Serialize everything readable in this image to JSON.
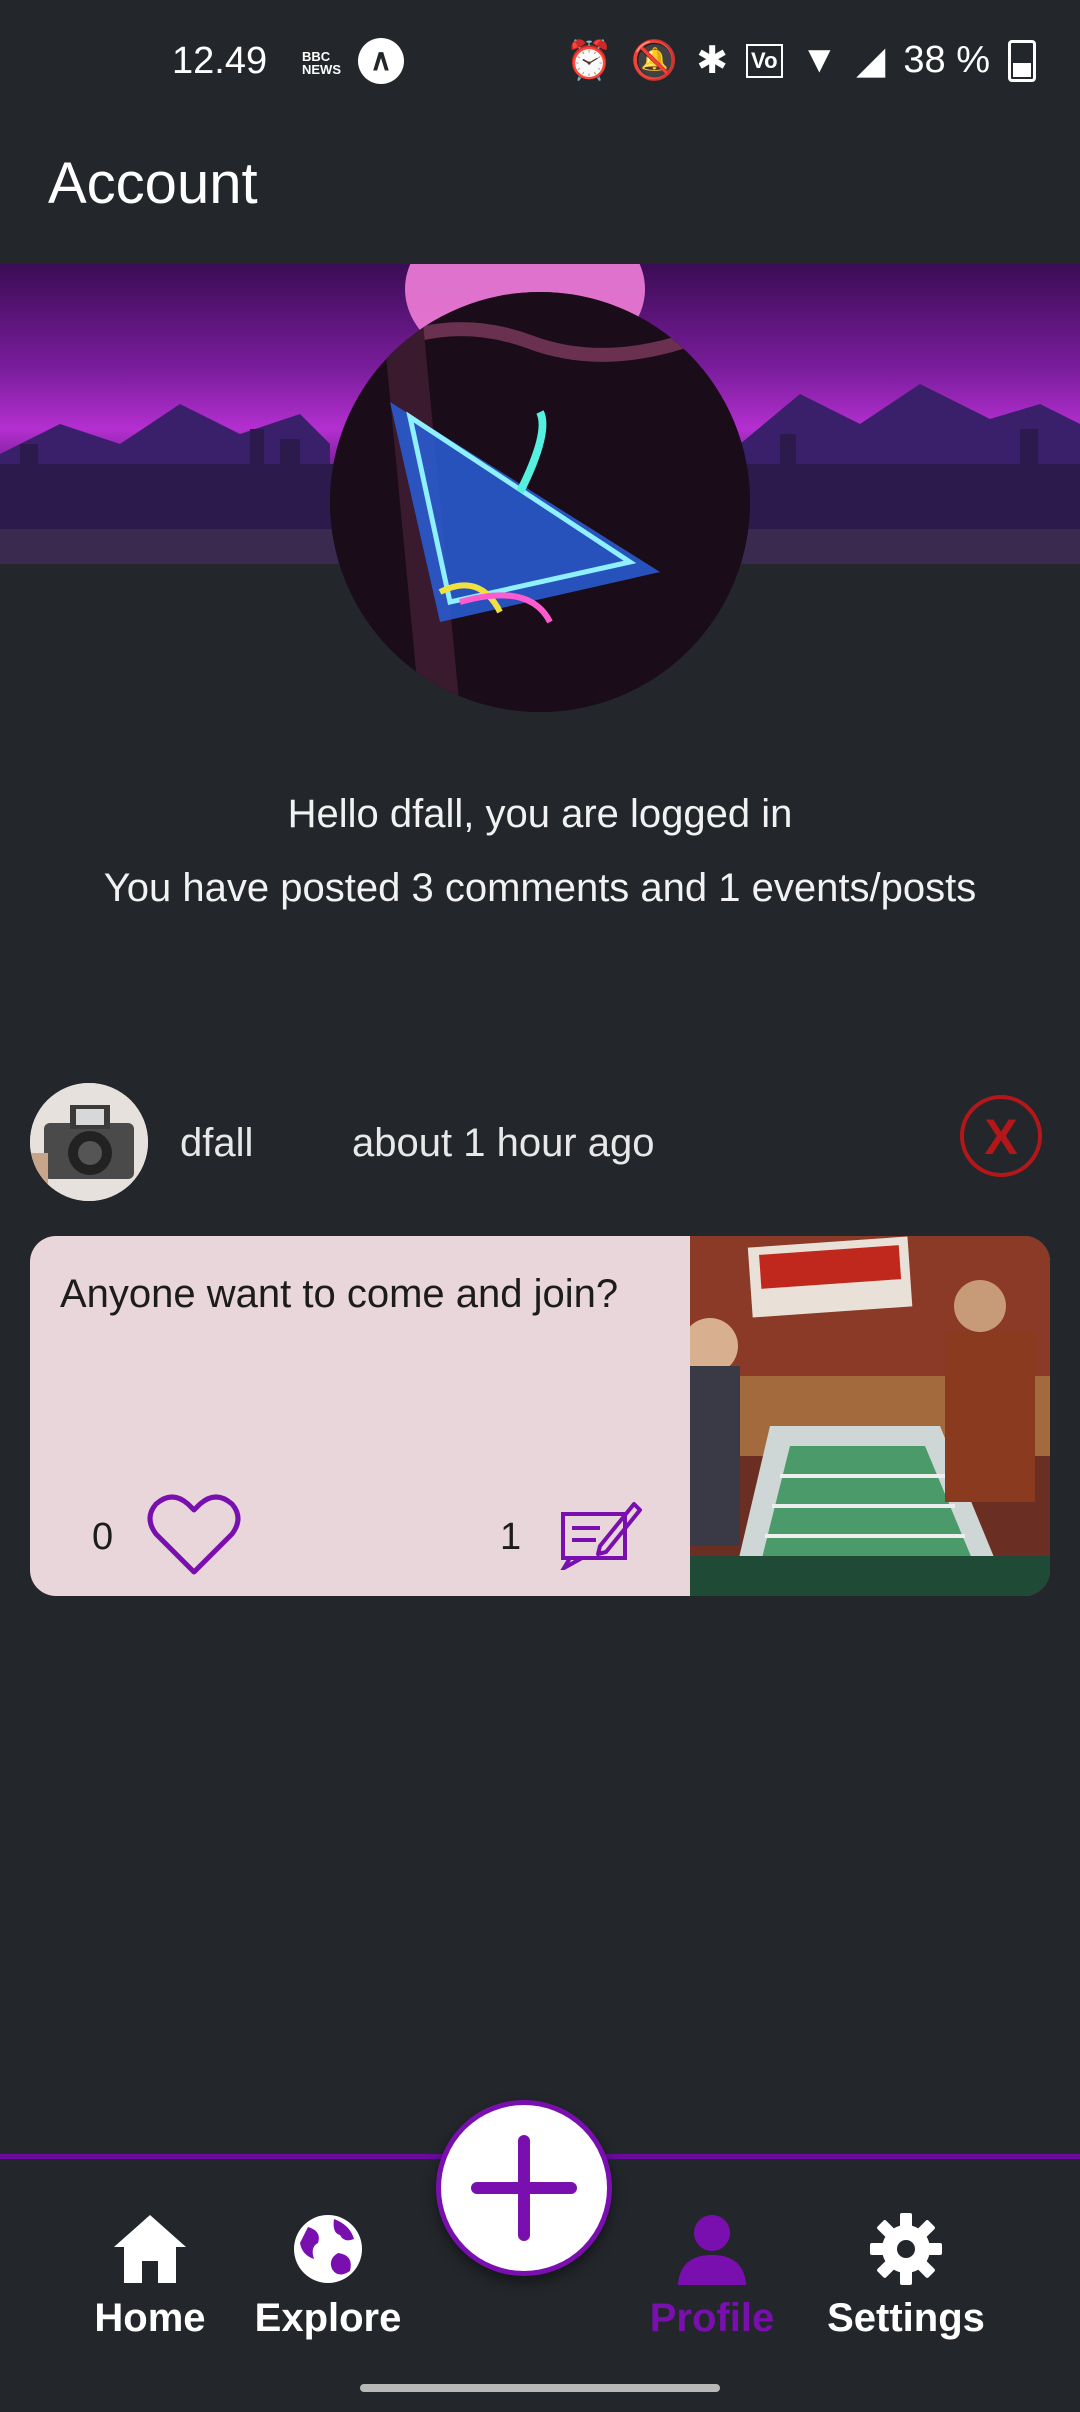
{
  "status_bar": {
    "time": "12.49",
    "bbc_news": "BBC NEWS",
    "battery": "38 %"
  },
  "app_bar": {
    "title": "Account"
  },
  "profile": {
    "greeting": "Hello dfall, you are logged in",
    "stats": "You have posted 3 comments and 1 events/posts"
  },
  "post": {
    "username": "dfall",
    "time_ago": "about 1 hour ago",
    "delete_label": "X",
    "text": "Anyone want to come and join?",
    "likes": "0",
    "comments": "1"
  },
  "bottom_nav": {
    "items": [
      {
        "label": "Home",
        "icon": "home-icon"
      },
      {
        "label": "Explore",
        "icon": "globe-icon"
      },
      {
        "label": "Profile",
        "icon": "person-icon"
      },
      {
        "label": "Settings",
        "icon": "gear-icon"
      }
    ],
    "active": "Profile",
    "fab_icon": "plus-icon"
  },
  "colors": {
    "background": "#23272b",
    "accent": "#7a0fb0",
    "card": "#e8d6da",
    "danger": "#b3171a"
  }
}
